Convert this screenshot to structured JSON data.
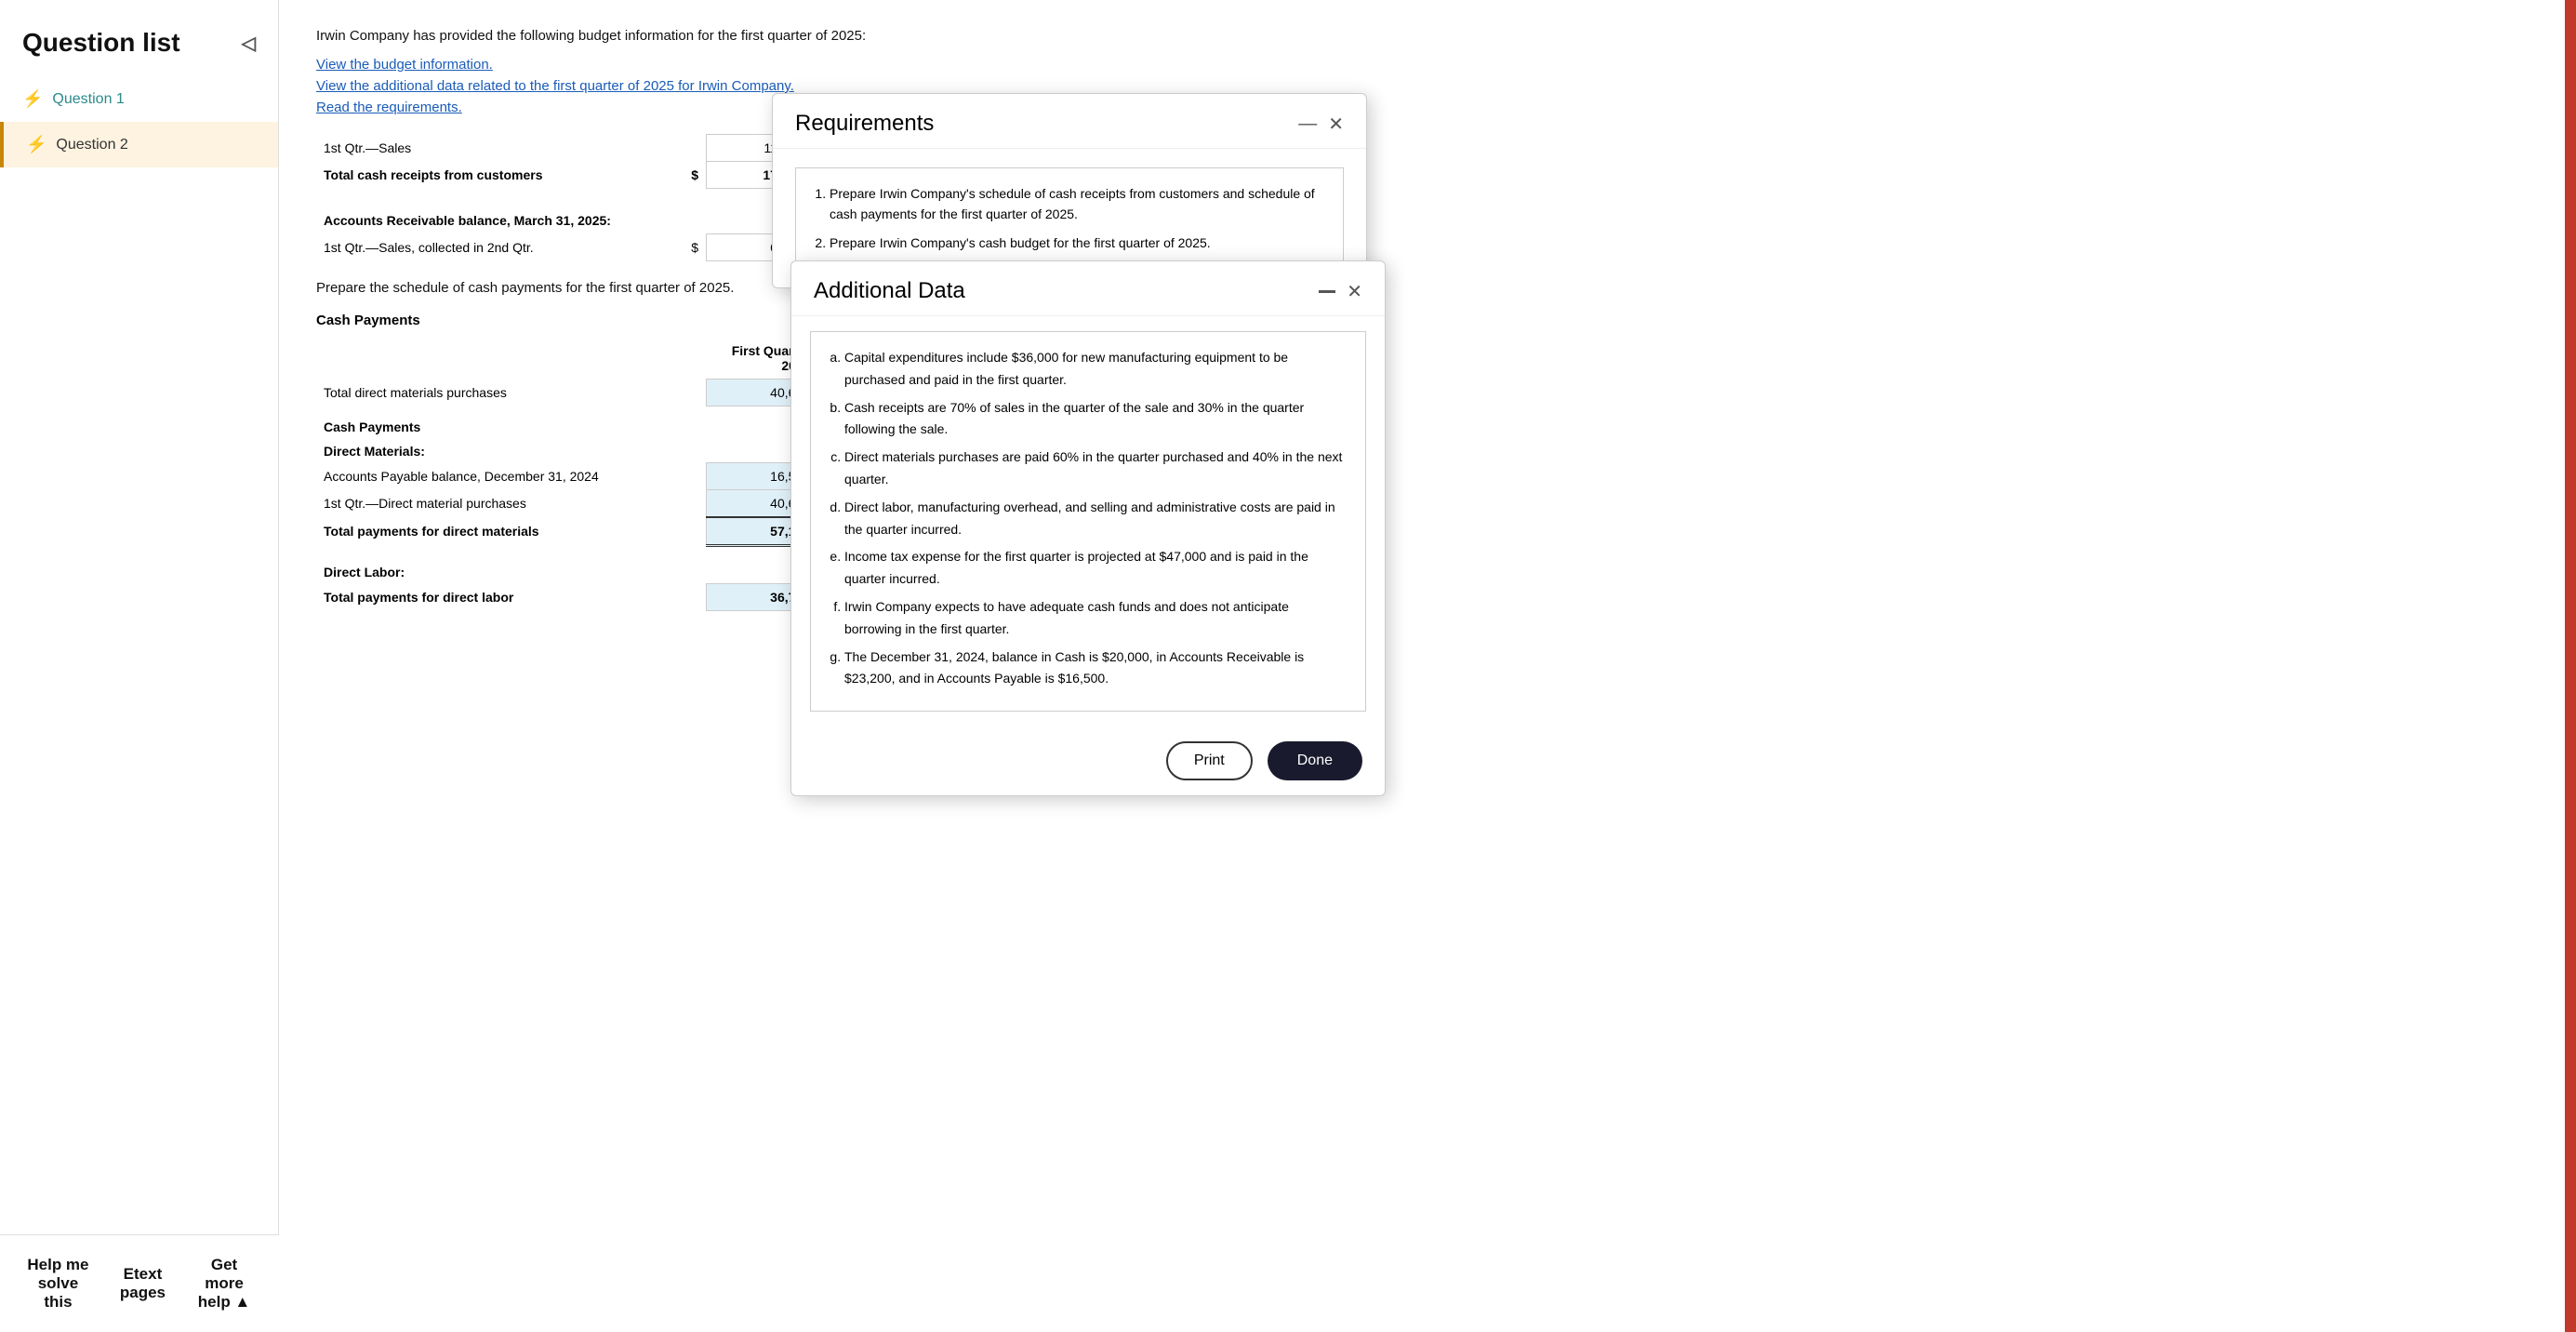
{
  "sidebar": {
    "title": "Question list",
    "collapse_icon": "◁",
    "items": [
      {
        "id": "q1",
        "label": "Question 1",
        "icon": "⚡",
        "active": false
      },
      {
        "id": "q2",
        "label": "Question 2",
        "icon": "⚡",
        "active": true
      }
    ]
  },
  "main": {
    "intro_text": "Irwin Company has provided the following budget information for the first quarter of 2025:",
    "links": [
      "View the budget information.",
      "View the additional data related to the first quarter of 2025 for Irwin Company.",
      "Read the requirements."
    ],
    "cash_receipts_table": {
      "rows": [
        {
          "label": "1st Qtr.—Sales",
          "dollar": "",
          "value": "110,100"
        },
        {
          "label": "Total cash receipts from customers",
          "dollar": "$",
          "value": "171,600",
          "bold": true
        }
      ]
    },
    "ar_balance": {
      "header": "Accounts Receivable balance, March 31, 2025:",
      "row": {
        "label": "1st Qtr.—Sales, collected in 2nd Qtr.",
        "dollar": "$",
        "value": "63,600"
      }
    },
    "cash_payments_intro": "Prepare the schedule of cash payments for the first quarter of 2025.",
    "cash_payments_header": "Cash Payments",
    "payments_table": {
      "col_header": "First Quarter",
      "col_subheader": "2025",
      "rows": [
        {
          "type": "data",
          "label": "Total direct materials purchases",
          "value": "40,600"
        },
        {
          "type": "section",
          "label": "Cash Payments"
        },
        {
          "type": "subsection",
          "label": "Direct Materials:"
        },
        {
          "type": "data",
          "label": "Accounts Payable balance, December 31, 2024",
          "value": "16,500"
        },
        {
          "type": "data",
          "label": "1st Qtr.—Direct material purchases",
          "value": "40,600"
        },
        {
          "type": "total",
          "label": "Total payments for direct materials",
          "value": "57,100"
        },
        {
          "type": "spacer"
        },
        {
          "type": "subsection",
          "label": "Direct Labor:"
        },
        {
          "type": "total",
          "label": "Total payments for direct labor",
          "value": "36,700"
        }
      ]
    }
  },
  "requirements_modal": {
    "title": "Requirements",
    "items": [
      "Prepare Irwin Company's schedule of cash receipts from customers and schedule of cash payments for the first quarter of 2025.",
      "Prepare Irwin Company's cash budget for the first quarter of 2025."
    ]
  },
  "additional_data_modal": {
    "title": "Additional Data",
    "items": [
      "Capital expenditures include $36,000 for new manufacturing equipment to be purchased and paid in the first quarter.",
      "Cash receipts are 70% of sales in the quarter of the sale and 30% in the quarter following the sale.",
      "Direct materials purchases are paid 60% in the quarter purchased and 40% in the next quarter.",
      "Direct labor, manufacturing overhead, and selling and administrative costs are paid in the quarter incurred.",
      "Income tax expense for the first quarter is projected at $47,000 and is paid in the quarter incurred.",
      "Irwin Company expects to have adequate cash funds and does not anticipate borrowing in the first quarter.",
      "The December 31, 2024, balance in Cash is $20,000, in Accounts Receivable is $23,200, and in Accounts Payable is $16,500."
    ],
    "print_label": "Print",
    "done_label": "Done"
  },
  "bottom_bar": {
    "help_label": "Help me solve this",
    "etext_label": "Etext pages",
    "more_help_label": "Get more help ▲"
  }
}
